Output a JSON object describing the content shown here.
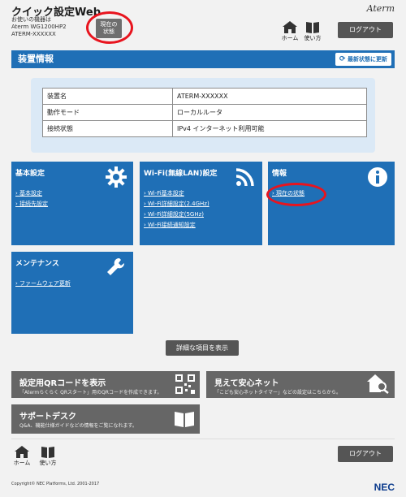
{
  "header": {
    "app_title": "クイック設定Web",
    "device_label": "お使いの機器は",
    "device_model": "Aterm WG1200HP2",
    "device_name": "ATERM-XXXXXX",
    "status_button": "現在の状態",
    "brand": "Aterm",
    "home_label": "ホーム",
    "help_label": "使い方",
    "logout_label": "ログアウト"
  },
  "device_info": {
    "title": "装置情報",
    "refresh_label": "最新状態に更新",
    "rows": [
      {
        "key": "装置名",
        "value": "ATERM-XXXXXX"
      },
      {
        "key": "動作モード",
        "value": "ローカルルータ"
      },
      {
        "key": "接続状態",
        "value": "IPv4 インターネット利用可能"
      }
    ]
  },
  "tiles": {
    "basic": {
      "title": "基本設定",
      "icon": "gear-icon",
      "links": [
        "基本設定",
        "接続先設定"
      ]
    },
    "wifi": {
      "title": "Wi-Fi(無線LAN)設定",
      "icon": "wifi-icon",
      "links": [
        "Wi-Fi基本設定",
        "Wi-Fi詳細設定(2.4GHz)",
        "Wi-Fi詳細設定(5GHz)",
        "Wi-Fi接続通知設定"
      ]
    },
    "info": {
      "title": "情報",
      "icon": "info-icon",
      "links": [
        "現在の状態"
      ]
    },
    "maintenance": {
      "title": "メンテナンス",
      "icon": "wrench-icon",
      "links": [
        "ファームウェア更新"
      ]
    }
  },
  "detail_button": "詳細な項目を表示",
  "cards": {
    "qr": {
      "title": "設定用QRコードを表示",
      "desc": "「Atermらくらく QRスタート」用のQRコードを作成できます。",
      "icon": "qr-code-icon"
    },
    "safety": {
      "title": "見えて安心ネット",
      "desc": "「こども安心ネットタイマー」などの設定はこちらから。",
      "icon": "house-search-icon"
    },
    "support": {
      "title": "サポートデスク",
      "desc": "Q&A、機能仕様ガイドなどの情報をご覧になれます。",
      "icon": "book-icon"
    }
  },
  "footer": {
    "home_label": "ホーム",
    "help_label": "使い方",
    "logout_label": "ログアウト",
    "copyright": "Copyright© NEC Platforms, Ltd. 2001-2017",
    "nec_logo": "NEC"
  },
  "colors": {
    "tile_blue": "#1f6fb6",
    "info_panel": "#dbe9f6",
    "highlight_ring": "#e8141e",
    "card_grey": "#666666",
    "background": "#f2f2f2"
  }
}
